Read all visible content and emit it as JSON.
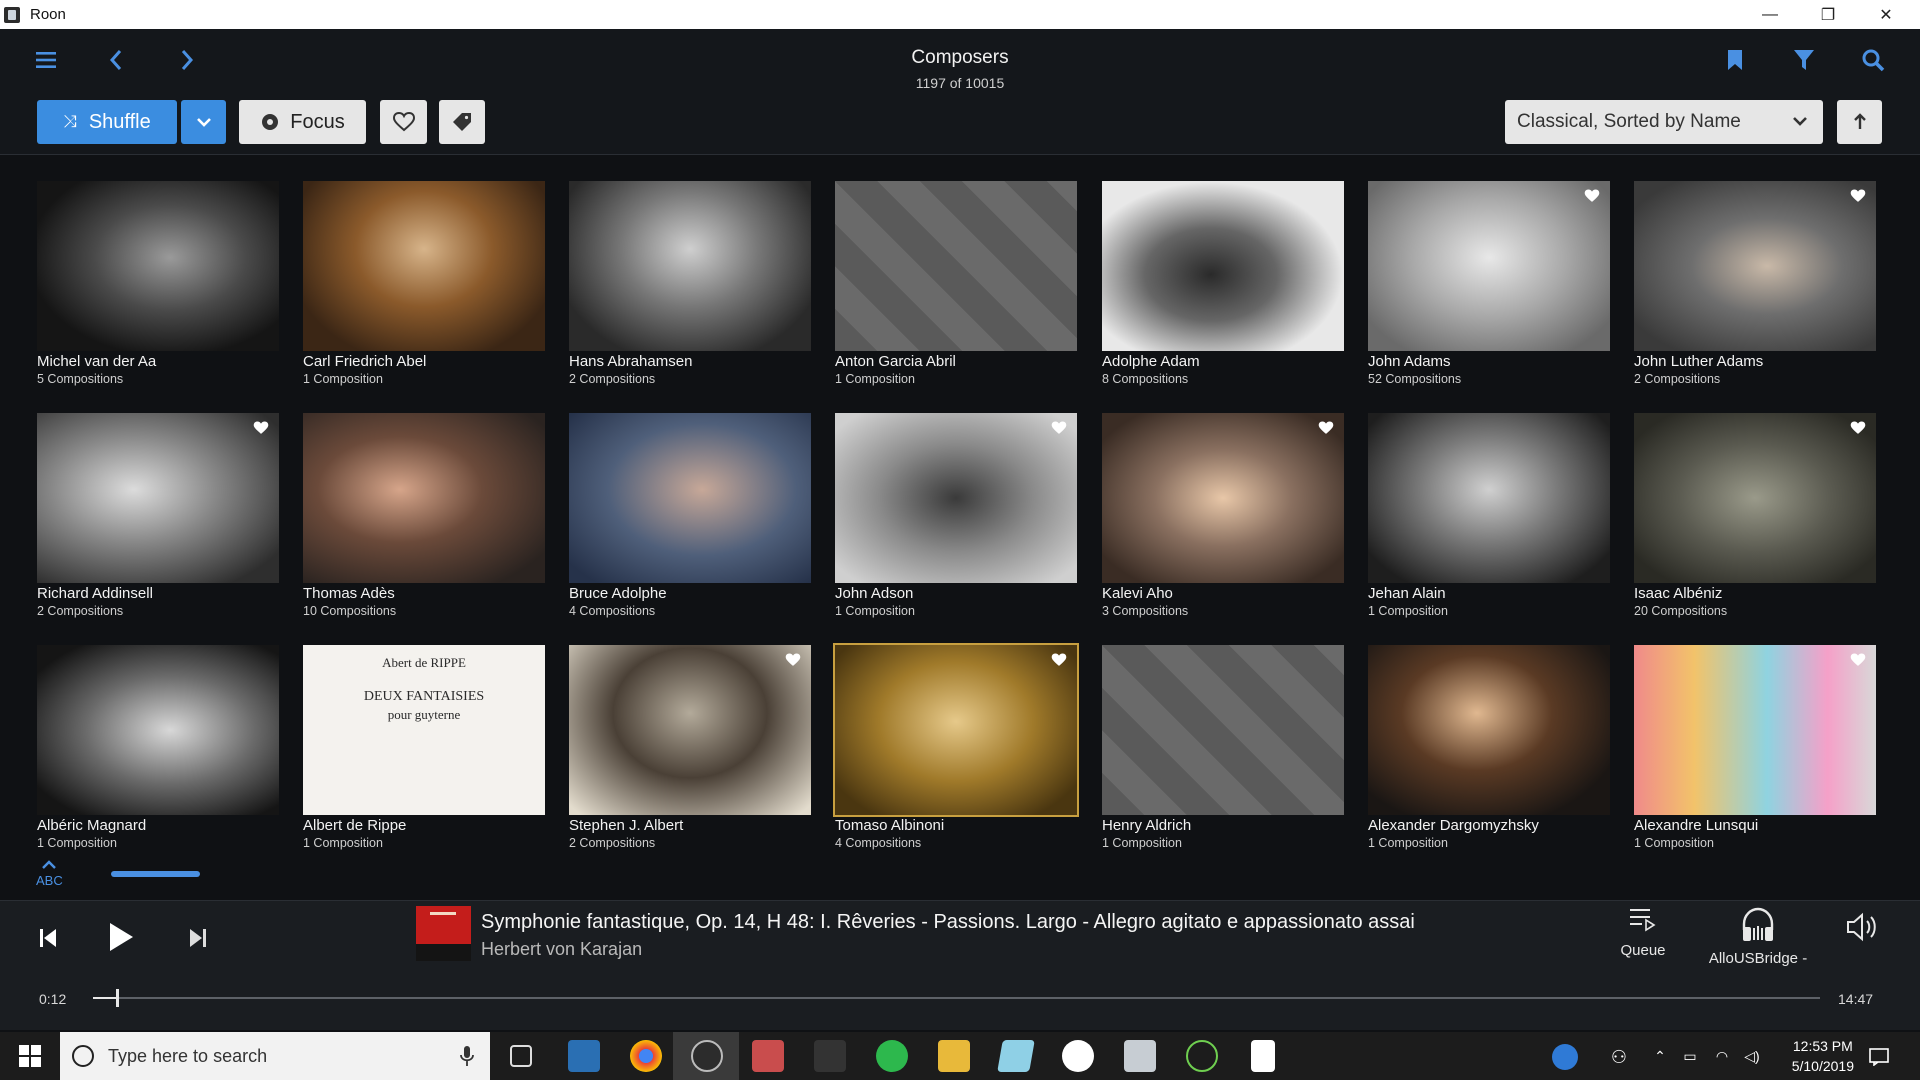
{
  "window": {
    "title": "Roon",
    "minimize": "—",
    "restore": "❐",
    "close": "✕"
  },
  "header": {
    "title": "Composers",
    "subtitle": "1197 of 10015",
    "shuffle_label": "Shuffle",
    "focus_label": "Focus",
    "sort_label": "Classical, Sorted by Name",
    "icons": [
      "menu-icon",
      "back-icon",
      "forward-icon",
      "bookmark-icon",
      "filter-icon",
      "search-icon"
    ]
  },
  "composers": [
    {
      "name": "Michel van der Aa",
      "count": "5 Compositions",
      "heart": false
    },
    {
      "name": "Carl Friedrich Abel",
      "count": "1 Composition",
      "heart": false
    },
    {
      "name": "Hans Abrahamsen",
      "count": "2 Compositions",
      "heart": false
    },
    {
      "name": "Anton Garcia Abril",
      "count": "1 Composition",
      "heart": false
    },
    {
      "name": "Adolphe Adam",
      "count": "8 Compositions",
      "heart": false
    },
    {
      "name": "John Adams",
      "count": "52 Compositions",
      "heart": true
    },
    {
      "name": "John Luther Adams",
      "count": "2 Compositions",
      "heart": true
    },
    {
      "name": "Richard Addinsell",
      "count": "2 Compositions",
      "heart": true
    },
    {
      "name": "Thomas Adès",
      "count": "10 Compositions",
      "heart": false
    },
    {
      "name": "Bruce Adolphe",
      "count": "4 Compositions",
      "heart": false
    },
    {
      "name": "John Adson",
      "count": "1 Composition",
      "heart": true
    },
    {
      "name": "Kalevi Aho",
      "count": "3 Compositions",
      "heart": true
    },
    {
      "name": "Jehan Alain",
      "count": "1 Composition",
      "heart": false
    },
    {
      "name": "Isaac Albéniz",
      "count": "20 Compositions",
      "heart": true
    },
    {
      "name": "Albéric Magnard",
      "count": "1 Composition",
      "heart": false
    },
    {
      "name": "Albert de Rippe",
      "count": "1 Composition",
      "heart": false
    },
    {
      "name": "Stephen J. Albert",
      "count": "2 Compositions",
      "heart": true
    },
    {
      "name": "Tomaso Albinoni",
      "count": "4 Compositions",
      "heart": true
    },
    {
      "name": "Henry Aldrich",
      "count": "1 Composition",
      "heart": false
    },
    {
      "name": "Alexander Dargomyzhsky",
      "count": "1 Composition",
      "heart": false
    },
    {
      "name": "Alexandre Lunsqui",
      "count": "1 Composition",
      "heart": true
    }
  ],
  "rippe_cover": {
    "line1": "Abert de RIPPE",
    "line2": "DEUX FANTAISIES",
    "line3": "pour guyterne"
  },
  "scroller": {
    "label": "ABC"
  },
  "player": {
    "track_title": "Symphonie fantastique, Op. 14, H 48: I. Rêveries - Passions. Largo - Allegro agitato e appassionato assai",
    "artist": "Herbert von Karajan",
    "elapsed": "0:12",
    "duration": "14:47",
    "progress": 0.0135,
    "queue_label": "Queue",
    "zone_label": "AlloUSBridge -"
  },
  "taskbar": {
    "search_placeholder": "Type here to search",
    "time": "12:53 PM",
    "date": "5/10/2019"
  }
}
